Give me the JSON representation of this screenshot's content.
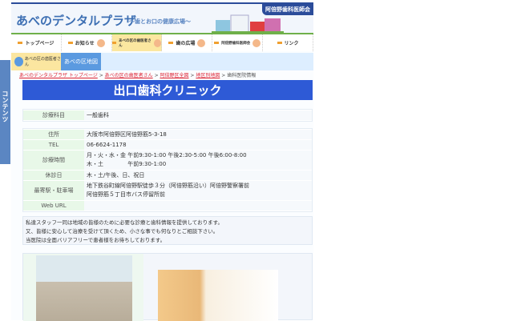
{
  "sidebar_tab": "コンテンツ",
  "header": {
    "logo": "あべのデンタルプラザ",
    "subtitle": "〜歯とお口の健康広場〜",
    "association": "阿倍野歯科医師会"
  },
  "nav": [
    "トップページ",
    "お知らせ",
    "あべの区の歯医者さん",
    "歯の広場",
    "阿倍野歯科医師会",
    "リンク"
  ],
  "subnav": {
    "current": "あべの区の歯医者さん",
    "map": "あべの区地図"
  },
  "breadcrumb": {
    "links": [
      "あべのデンタルプラザ トップページ",
      "あべの区の歯医者さん",
      "阿倍野区全図",
      "地区別地図"
    ],
    "current": "歯科医院情報",
    "sep": " > "
  },
  "clinic_name": "出口歯科クリニック",
  "dept": {
    "label": "診療科目",
    "value": "一般歯科"
  },
  "info": [
    {
      "label": "住所",
      "lines": [
        "大阪市阿倍野区阿倍野筋5-3-18"
      ]
    },
    {
      "label": "TEL",
      "lines": [
        "06-6624-1178"
      ]
    },
    {
      "label": "診療時間",
      "lines": [
        "月・火・水・金 午前9:30-1:00 午後2:30-5:00 午後6:00-8:00",
        "木・土　　　　 午前9:30-1:00"
      ]
    },
    {
      "label": "休診日",
      "lines": [
        "木・土/午後、日、祝日"
      ]
    },
    {
      "label": "最寄駅・駐車場",
      "lines": [
        "地下鉄谷町線阿倍野駅徒歩３分（阿倍野筋沿い）阿倍野警察署前",
        "阿倍野筋５丁目市バス停留所前"
      ]
    },
    {
      "label": "Web URL",
      "lines": [
        ""
      ]
    }
  ],
  "message": [
    "私達スタッフ一同は地域の皆様のために必要な診療と歯科情報を提供しております。",
    "又、皆様に安心して治療を受けて頂くため、小さな事でも何なりとご相談下さい。",
    "当医院は全面バリアフリーで患者様をお待ちしております。"
  ],
  "colors": {
    "title_bg": "#2e5ad6",
    "label_bg": "#e8f8e8",
    "nav_active": "#fbe7a0"
  }
}
